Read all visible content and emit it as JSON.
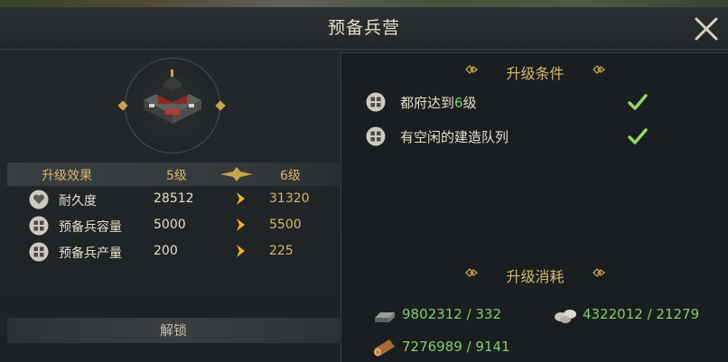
{
  "window": {
    "title": "预备兵营",
    "close_icon": "close-icon"
  },
  "upgrade_effects": {
    "header_label": "升级效果",
    "current_level": "5级",
    "next_level": "6级",
    "rows": [
      {
        "icon": "heart-icon",
        "label": "耐久度",
        "current": "28512",
        "next": "31320"
      },
      {
        "icon": "grid-icon",
        "label": "预备兵容量",
        "current": "5000",
        "next": "5500"
      },
      {
        "icon": "grid-icon",
        "label": "预备兵产量",
        "current": "200",
        "next": "225"
      }
    ],
    "unlock_label": "解锁"
  },
  "conditions": {
    "title": "升级条件",
    "items": [
      {
        "icon": "grid-icon",
        "text_before": "都府达到",
        "highlight": "6",
        "text_after": "级",
        "met": true
      },
      {
        "icon": "grid-icon",
        "text_before": "有空闲的建造队列",
        "highlight": "",
        "text_after": "",
        "met": true
      }
    ]
  },
  "costs": {
    "title": "升级消耗",
    "items": [
      {
        "icon": "iron-ingot-icon",
        "value": "9802312 / 332"
      },
      {
        "icon": "stone-icon",
        "value": "4322012 / 21279"
      },
      {
        "icon": "wood-log-icon",
        "value": "7276989 / 9141"
      }
    ]
  },
  "colors": {
    "gold": "#d6b76a",
    "green": "#7ed06a",
    "text": "#e4ddcc"
  }
}
